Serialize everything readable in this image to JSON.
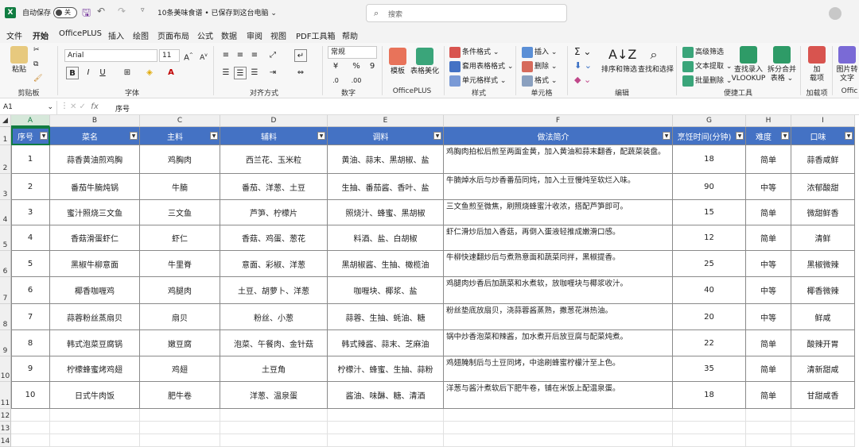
{
  "titlebar": {
    "app_icon": "X",
    "autosave_label": "自动保存",
    "autosave_state": "关",
    "file_title": "10条美味食谱 • 已保存到这台电脑",
    "search_placeholder": "搜索"
  },
  "menu": [
    "文件",
    "开始",
    "OfficePLUS",
    "插入",
    "绘图",
    "页面布局",
    "公式",
    "数据",
    "审阅",
    "视图",
    "PDF工具箱",
    "帮助"
  ],
  "menu_active": "开始",
  "ribbon": {
    "clipboard": {
      "paste": "粘贴",
      "group": "剪贴板"
    },
    "font": {
      "name": "Arial",
      "size": "11",
      "group": "字体"
    },
    "alignment": {
      "group": "对齐方式"
    },
    "number": {
      "format": "常规",
      "group": "数字"
    },
    "officeplus": {
      "template": "模板",
      "beautify": "表格美化",
      "group": "OfficePLUS"
    },
    "styles": {
      "conditional": "条件格式",
      "table_format": "套用表格格式",
      "cell_style": "单元格样式",
      "group": "样式"
    },
    "cells": {
      "insert": "插入",
      "delete": "删除",
      "format": "格式",
      "group": "单元格"
    },
    "editing": {
      "sort_filter": "排序和筛选",
      "find_select": "查找和选择",
      "group": "编辑"
    },
    "tools": {
      "adv_filter": "高级筛选",
      "text_extract": "文本提取",
      "batch_delete": "批量删除",
      "vlookup_1": "查找录入",
      "vlookup_2": "VLOOKUP",
      "split_1": "拆分合并",
      "split_2": "表格",
      "group": "便捷工具"
    },
    "addins": {
      "label_1": "加",
      "label_2": "载项",
      "group": "加载项"
    },
    "extra": {
      "label_1": "图片转",
      "label_2": "文字",
      "group": "Offic"
    }
  },
  "formula_bar": {
    "name_box": "A1",
    "fx": "fx",
    "content": "序号"
  },
  "columns": [
    "A",
    "B",
    "C",
    "D",
    "E",
    "F",
    "G",
    "H",
    "I"
  ],
  "table": {
    "headers": [
      "序号",
      "菜名",
      "主料",
      "辅料",
      "调料",
      "做法简介",
      "烹饪时间(分钟)",
      "难度",
      "口味"
    ],
    "rows": [
      [
        "1",
        "蒜香黄油煎鸡胸",
        "鸡胸肉",
        "西兰花、玉米粒",
        "黄油、蒜末、黑胡椒、盐",
        "鸡胸肉拍松后煎至两面金黄，加入黄油和蒜末翻香，配蔬菜装盘。",
        "18",
        "简单",
        "蒜香咸鲜"
      ],
      [
        "2",
        "番茄牛腩炖锅",
        "牛腩",
        "番茄、洋葱、土豆",
        "生抽、番茄酱、香叶、盐",
        "牛腩焯水后与炒香番茄同炖，加入土豆慢炖至软烂入味。",
        "90",
        "中等",
        "浓郁酸甜"
      ],
      [
        "3",
        "蜜汁照烧三文鱼",
        "三文鱼",
        "芦笋、柠檬片",
        "照烧汁、蜂蜜、黑胡椒",
        "三文鱼煎至微焦，刷照烧蜂蜜汁收浓，搭配芦笋即可。",
        "15",
        "简单",
        "微甜鲜香"
      ],
      [
        "4",
        "香菇滑蛋虾仁",
        "虾仁",
        "香菇、鸡蛋、葱花",
        "料酒、盐、白胡椒",
        "虾仁滑炒后加入香菇，再倒入蛋液轻推成嫩滑口感。",
        "12",
        "简单",
        "清鲜"
      ],
      [
        "5",
        "黑椒牛柳意面",
        "牛里脊",
        "意面、彩椒、洋葱",
        "黑胡椒酱、生抽、橄榄油",
        "牛柳快速翻炒后与煮熟意面和蔬菜同拌，黑椒提香。",
        "25",
        "中等",
        "黑椒微辣"
      ],
      [
        "6",
        "椰香咖喱鸡",
        "鸡腿肉",
        "土豆、胡萝卜、洋葱",
        "咖喱块、椰浆、盐",
        "鸡腿肉炒香后加蔬菜和水煮软，放咖喱块与椰浆收汁。",
        "40",
        "中等",
        "椰香微辣"
      ],
      [
        "7",
        "蒜蓉粉丝蒸扇贝",
        "扇贝",
        "粉丝、小葱",
        "蒜蓉、生抽、蚝油、糖",
        "粉丝垫底放扇贝，浇蒜蓉酱蒸熟，撒葱花淋热油。",
        "20",
        "中等",
        "鲜咸"
      ],
      [
        "8",
        "韩式泡菜豆腐锅",
        "嫩豆腐",
        "泡菜、午餐肉、金针菇",
        "韩式辣酱、蒜末、芝麻油",
        "锅中炒香泡菜和辣酱，加水煮开后放豆腐与配菜炖煮。",
        "22",
        "简单",
        "酸辣开胃"
      ],
      [
        "9",
        "柠檬蜂蜜烤鸡翅",
        "鸡翅",
        "土豆角",
        "柠檬汁、蜂蜜、生抽、蒜粉",
        "鸡翅腌制后与土豆同烤，中途刷蜂蜜柠檬汁至上色。",
        "35",
        "简单",
        "清新甜咸"
      ],
      [
        "10",
        "日式牛肉饭",
        "肥牛卷",
        "洋葱、温泉蛋",
        "酱油、味醂、糖、清酒",
        "洋葱与酱汁煮软后下肥牛卷，铺在米饭上配温泉蛋。",
        "18",
        "简单",
        "甘甜咸香"
      ]
    ]
  },
  "row_numbers": [
    "1",
    "2",
    "3",
    "4",
    "5",
    "6",
    "7",
    "8",
    "9",
    "10",
    "11",
    "12",
    "13",
    "14"
  ],
  "colors": {
    "header_fill": "#4472c4",
    "accent": "#107c41"
  }
}
